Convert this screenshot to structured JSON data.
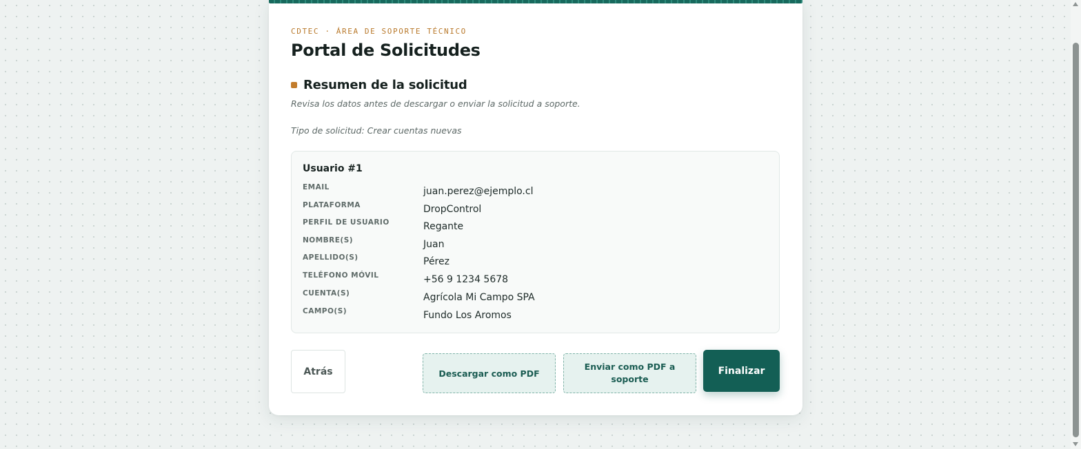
{
  "header": {
    "eyebrow": "CDTEC · ÁREA DE SOPORTE TÉCNICO",
    "title": "Portal de Solicitudes"
  },
  "summary": {
    "title": "Resumen de la solicitud",
    "description": "Revisa los datos antes de descargar o enviar la solicitud a soporte.",
    "request_type": "Tipo de solicitud: Crear cuentas nuevas"
  },
  "user": {
    "heading": "Usuario #1",
    "fields": [
      {
        "label": "EMAIL",
        "value": "juan.perez@ejemplo.cl"
      },
      {
        "label": "PLATAFORMA",
        "value": "DropControl"
      },
      {
        "label": "PERFIL DE USUARIO",
        "value": "Regante"
      },
      {
        "label": "NOMBRE(S)",
        "value": "Juan"
      },
      {
        "label": "APELLIDO(S)",
        "value": "Pérez"
      },
      {
        "label": "TELÉFONO MÓVIL",
        "value": "+56 9 1234 5678"
      },
      {
        "label": "CUENTA(S)",
        "value": "Agrícola Mi Campo SPA"
      },
      {
        "label": "CAMPO(S)",
        "value": "Fundo Los Aromos"
      }
    ]
  },
  "actions": {
    "back_label": "Atrás",
    "download_pdf_label": "Descargar como PDF",
    "send_pdf_label": "Enviar como PDF a soporte",
    "finish_label": "Finalizar"
  },
  "colors": {
    "accent": "#135f55",
    "highlight": "#b8782a",
    "background": "#eef2f1"
  },
  "icons": {
    "section_marker": "square-bullet-icon",
    "scroll_up": "triangle-up-icon",
    "scroll_down": "triangle-down-icon"
  }
}
